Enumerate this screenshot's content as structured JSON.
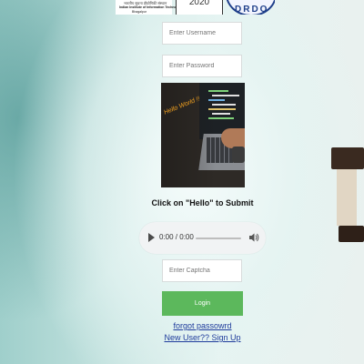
{
  "logos": {
    "institute_line1": "भारतीय सूचना प्रौद्योगिकी संस्थान",
    "institute_line2": "Indian Institute of Information Technology",
    "institute_line3": "Bhagalpur",
    "year": "2020",
    "drdo": "DRDO"
  },
  "form": {
    "username_placeholder": "Enter Username",
    "password_placeholder": "Enter Password",
    "captcha_placeholder": "Enter Captcha",
    "instruction": "Click on \"Hello\" to Submit",
    "login_label": "Login"
  },
  "image": {
    "caption": "Hello World !!"
  },
  "audio": {
    "time": "0:00 / 0:00",
    "progress": 0
  },
  "links": {
    "forgot_password": "forgot passowrd",
    "signup": "New User?? Sign Up"
  },
  "colors": {
    "login_button": "#5cb85c",
    "link": "#1f3c9c"
  }
}
